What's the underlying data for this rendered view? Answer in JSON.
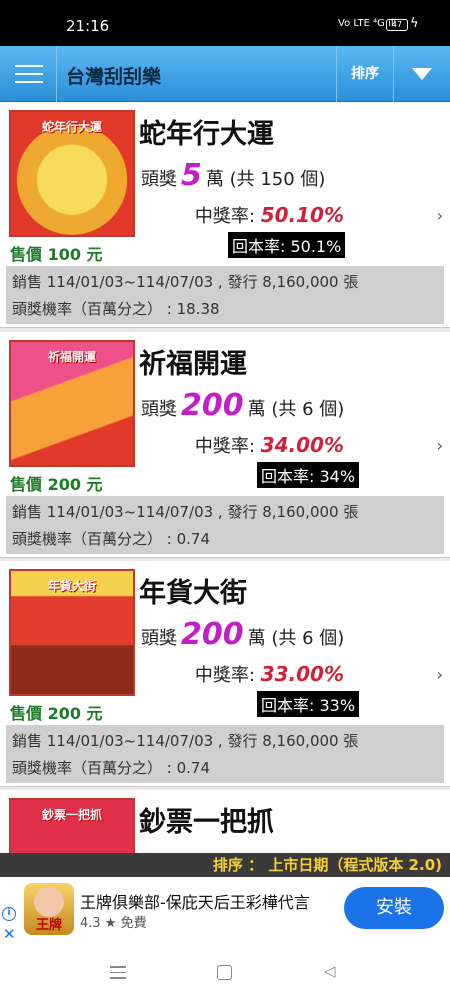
{
  "status_bar": {
    "time": "21:16",
    "signal": "Vo LTE ⁴G ıll",
    "battery": "47"
  },
  "app_bar": {
    "title": "台灣刮刮樂",
    "sort_label": "排序"
  },
  "tickets": [
    {
      "name": "蛇年行大運",
      "thumb_text": "蛇年行大運",
      "price": "售價 100 元",
      "prize_prefix": "頭獎",
      "prize_amount": "5",
      "prize_suffix": "萬 (共 150 個)",
      "win_rate_label": "中獎率: ",
      "win_rate": "50.10%",
      "return_rate": "回本率: 50.1%",
      "sales": "銷售 114/01/03~114/07/03 , 發行 8,160,000 張",
      "top_prize_odds": "頭獎機率（百萬分之） : 18.38",
      "colors": [
        "#f5c84a",
        "#e23a2a"
      ]
    },
    {
      "name": "祈福開運",
      "thumb_text": "祈福開運",
      "price": "售價 200 元",
      "prize_prefix": "頭獎",
      "prize_amount": "200",
      "prize_suffix": "萬 (共 6 個)",
      "win_rate_label": "中獎率: ",
      "win_rate": "34.00%",
      "return_rate": "回本率: 34%",
      "sales": "銷售 114/01/03~114/07/03 , 發行 8,160,000 張",
      "top_prize_odds": "頭獎機率（百萬分之） : 0.74",
      "colors": [
        "#f0508a",
        "#f7a13a"
      ]
    },
    {
      "name": "年貨大街",
      "thumb_text": "年貨大街",
      "price": "售價 200 元",
      "prize_prefix": "頭獎",
      "prize_amount": "200",
      "prize_suffix": "萬 (共 6 個)",
      "win_rate_label": "中獎率: ",
      "win_rate": "33.00%",
      "return_rate": "回本率: 33%",
      "sales": "銷售 114/01/03~114/07/03 , 發行 8,160,000 張",
      "top_prize_odds": "頭獎機率（百萬分之） : 0.74",
      "colors": [
        "#e33b2c",
        "#f3d04e"
      ]
    },
    {
      "name": "鈔票一把抓",
      "thumb_text": "鈔票一把抓",
      "colors": [
        "#e0304a",
        "#f0b530"
      ]
    }
  ],
  "sort_footer": "排序 ： 上市日期（程式版本 2.0)",
  "ad": {
    "logo_text": "王牌",
    "title": "王牌俱樂部-保庇天后王彩樺代言",
    "meta": "4.3 ★ 免費",
    "install_label": "安裝"
  }
}
